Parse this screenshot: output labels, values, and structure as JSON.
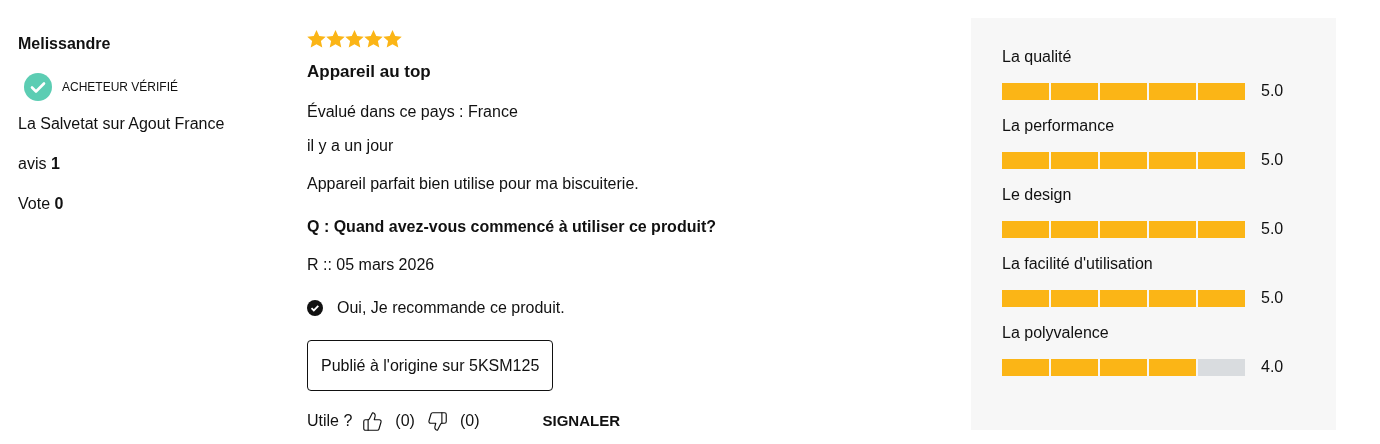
{
  "reviewer": {
    "name": "Melissandre",
    "verified": true,
    "verified_label": "ACHETEUR VÉRIFIÉ",
    "location": "La Salvetat sur Agout France",
    "reviews": "avis **1**",
    "votes": "Vote **0**"
  },
  "review": {
    "stars": 5,
    "title": "Appareil au top",
    "country": "Évalué dans ce pays : France",
    "date": "il y a un jour",
    "body": "Appareil parfait bien utilise pour ma biscuiterie.",
    "question": "Q : Quand avez-vous commencé à utiliser ce produit?",
    "answer": "R :: 05 mars 2026",
    "recommended": true,
    "recommend_text": "Oui, Je recommande ce produit.",
    "origin_button": "Publié à l'origine sur 5KSM125",
    "helpful_label": "Utile ?",
    "helpful_count": "(0)",
    "unhelpful_count": "(0)",
    "report": "SIGNALER"
  },
  "ratings": [
    {
      "label": "La qualité",
      "stars": 5,
      "value": "5.0"
    },
    {
      "label": "La performance",
      "stars": 5,
      "value": "5.0"
    },
    {
      "label": "Le design",
      "stars": 5,
      "value": "5.0"
    },
    {
      "label": "La facilité d'utilisation",
      "stars": 5,
      "value": "5.0"
    },
    {
      "label": "La polyvalence",
      "stars": 4,
      "value": "4.0"
    }
  ]
}
